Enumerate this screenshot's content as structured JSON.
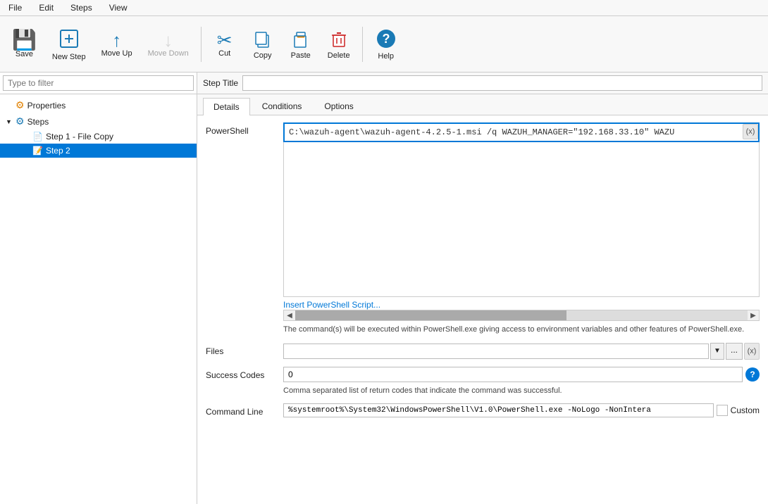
{
  "menubar": {
    "items": [
      "File",
      "Edit",
      "Steps",
      "View"
    ]
  },
  "toolbar": {
    "buttons": [
      {
        "id": "save",
        "label": "Save",
        "icon": "💾",
        "icon_class": "icon-blue",
        "disabled": false
      },
      {
        "id": "new-step",
        "label": "New Step",
        "icon": "✦",
        "icon_class": "icon-blue",
        "disabled": false
      },
      {
        "id": "move-up",
        "label": "Move Up",
        "icon": "⬆",
        "icon_class": "icon-blue",
        "disabled": false
      },
      {
        "id": "move-down",
        "label": "Move Down",
        "icon": "⬇",
        "icon_class": "icon-gray",
        "disabled": true
      },
      {
        "id": "cut",
        "label": "Cut",
        "icon": "✂",
        "icon_class": "icon-blue",
        "disabled": false
      },
      {
        "id": "copy",
        "label": "Copy",
        "icon": "📄",
        "icon_class": "icon-blue",
        "disabled": false
      },
      {
        "id": "paste",
        "label": "Paste",
        "icon": "📋",
        "icon_class": "icon-orange",
        "disabled": false
      },
      {
        "id": "delete",
        "label": "Delete",
        "icon": "🗑",
        "icon_class": "icon-red",
        "disabled": false
      },
      {
        "id": "help",
        "label": "Help",
        "icon": "❓",
        "icon_class": "icon-teal",
        "disabled": false
      }
    ]
  },
  "left_panel": {
    "filter_placeholder": "Type to filter",
    "tree": {
      "properties_label": "Properties",
      "steps_label": "Steps",
      "step1_label": "Step 1 - File Copy",
      "step2_label": "Step 2"
    }
  },
  "right_panel": {
    "step_title_label": "Step Title",
    "step_title_value": "",
    "tabs": [
      "Details",
      "Conditions",
      "Options"
    ],
    "active_tab": "Details",
    "details": {
      "powershell_label": "PowerShell",
      "powershell_value": "C:\\wazuh-agent\\wazuh-agent-4.2.5-1.msi /q WAZUH_MANAGER=\"192.168.33.10\" WAZU",
      "insert_link": "Insert PowerShell Script...",
      "ps_info": "The command(s) will be executed within PowerShell.exe giving access to environment variables and other features of PowerShell.exe.",
      "files_label": "Files",
      "files_value": "",
      "success_codes_label": "Success Codes",
      "success_codes_value": "0",
      "success_codes_info": "Comma separated list of return codes that indicate the command was successful.",
      "command_line_label": "Command Line",
      "command_line_value": "%systemroot%\\System32\\WindowsPowerShell\\V1.0\\PowerShell.exe -NoLogo -NonIntera",
      "command_line_custom": "Custom",
      "x_label": "(x)"
    }
  }
}
